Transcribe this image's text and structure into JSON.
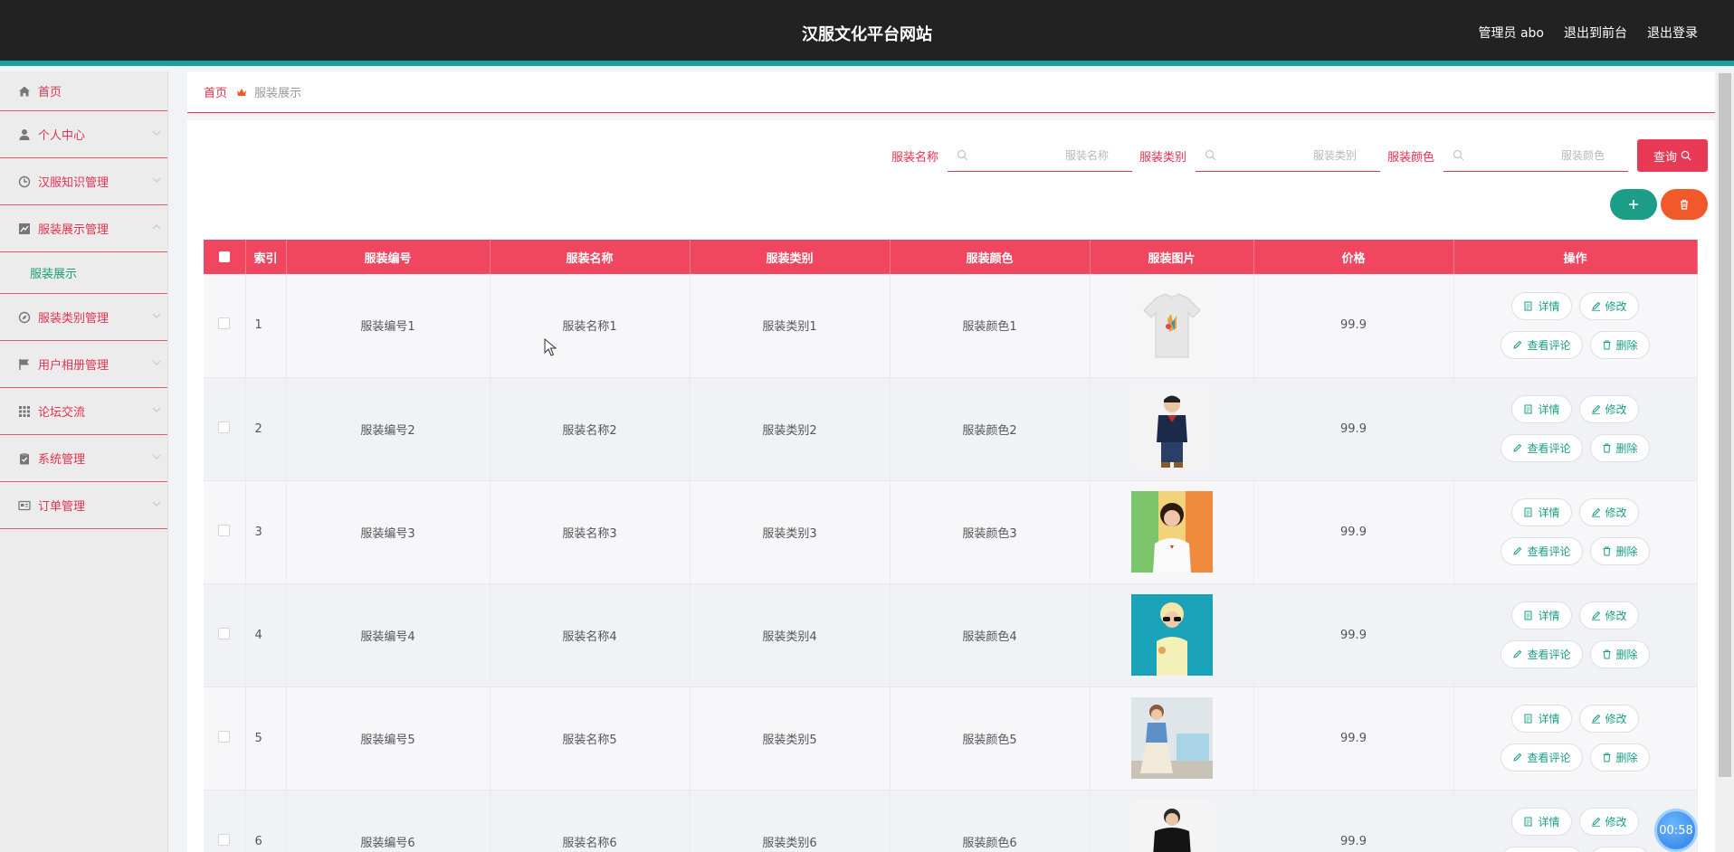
{
  "header": {
    "title": "汉服文化平台网站",
    "user": "管理员 abo",
    "to_front": "退出到前台",
    "logout": "退出登录"
  },
  "sidebar": {
    "items": [
      {
        "label": "首页",
        "icon": "home-icon"
      },
      {
        "label": "个人中心",
        "icon": "user-icon"
      },
      {
        "label": "汉服知识管理",
        "icon": "clock-icon"
      },
      {
        "label": "服装展示管理",
        "icon": "chart-icon",
        "expanded": true
      },
      {
        "label": "服装类别管理",
        "icon": "compass-icon"
      },
      {
        "label": "用户相册管理",
        "icon": "flag-icon"
      },
      {
        "label": "论坛交流",
        "icon": "grid-icon"
      },
      {
        "label": "系统管理",
        "icon": "clipboard-icon"
      },
      {
        "label": "订单管理",
        "icon": "card-icon"
      }
    ],
    "sub_item": "服装展示"
  },
  "breadcrumb": {
    "home": "首页",
    "current": "服装展示"
  },
  "search": {
    "name_label": "服装名称",
    "name_placeholder": "服装名称",
    "type_label": "服装类别",
    "type_placeholder": "服装类别",
    "color_label": "服装颜色",
    "color_placeholder": "服装颜色",
    "query_button": "查询"
  },
  "table": {
    "headers": [
      "索引",
      "服装编号",
      "服装名称",
      "服装类别",
      "服装颜色",
      "服装图片",
      "价格",
      "操作"
    ],
    "rows": [
      {
        "index": "1",
        "code": "服装编号1",
        "name": "服装名称1",
        "type": "服装类别1",
        "color": "服装颜色1",
        "price": "99.9"
      },
      {
        "index": "2",
        "code": "服装编号2",
        "name": "服装名称2",
        "type": "服装类别2",
        "color": "服装颜色2",
        "price": "99.9"
      },
      {
        "index": "3",
        "code": "服装编号3",
        "name": "服装名称3",
        "type": "服装类别3",
        "color": "服装颜色3",
        "price": "99.9"
      },
      {
        "index": "4",
        "code": "服装编号4",
        "name": "服装名称4",
        "type": "服装类别4",
        "color": "服装颜色4",
        "price": "99.9"
      },
      {
        "index": "5",
        "code": "服装编号5",
        "name": "服装名称5",
        "type": "服装类别5",
        "color": "服装颜色5",
        "price": "99.9"
      },
      {
        "index": "6",
        "code": "服装编号6",
        "name": "服装名称6",
        "type": "服装类别6",
        "color": "服装颜色6",
        "price": "99.9"
      }
    ],
    "actions": {
      "detail": "详情",
      "edit": "修改",
      "comments": "查看评论",
      "delete": "删除"
    }
  },
  "timer": "00:58",
  "colors": {
    "accent": "#e3314f",
    "header_bg": "#222222",
    "teal": "#1b9d88",
    "orange": "#f2592a"
  }
}
